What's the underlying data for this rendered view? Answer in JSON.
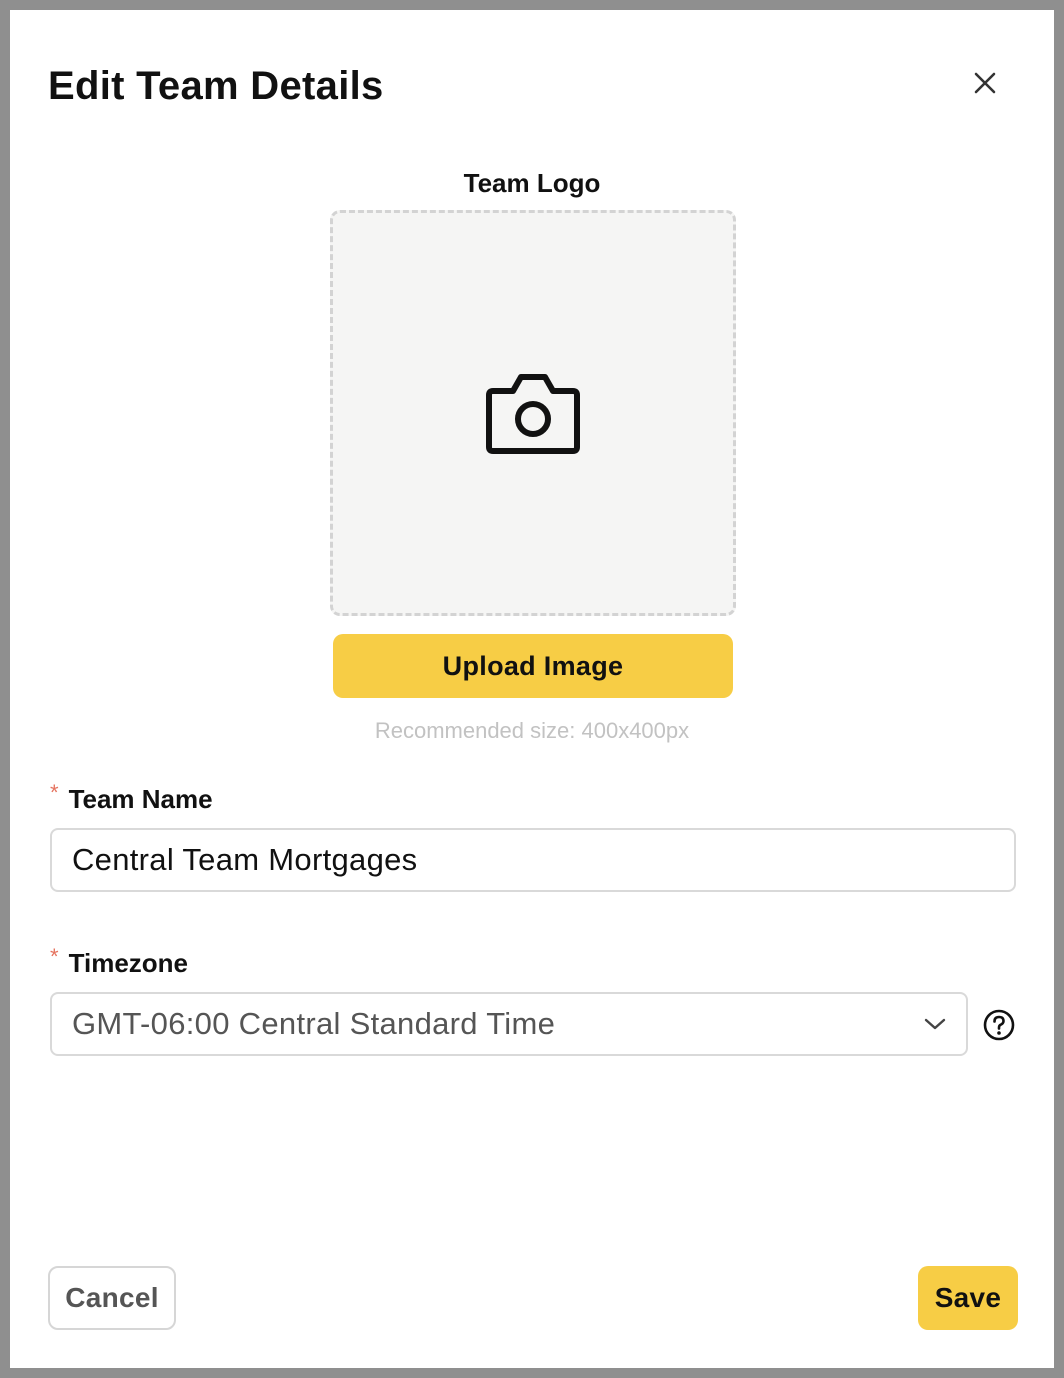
{
  "dialog": {
    "title": "Edit Team Details",
    "close_icon": "close-icon"
  },
  "logo": {
    "label": "Team Logo",
    "placeholder_icon": "camera-icon",
    "upload_label": "Upload Image",
    "hint": "Recommended size: 400x400px"
  },
  "team_name": {
    "required_marker": "*",
    "label": "Team Name",
    "value": "Central Team Mortgages"
  },
  "timezone": {
    "required_marker": "*",
    "label": "Timezone",
    "value": "GMT-06:00 Central Standard Time",
    "dropdown_icon": "chevron-down-icon",
    "help_icon": "question-circle-icon"
  },
  "footer": {
    "cancel_label": "Cancel",
    "save_label": "Save"
  },
  "colors": {
    "accent": "#f7cd45",
    "required": "#e5735f",
    "backdrop": "#8f8f8f"
  }
}
